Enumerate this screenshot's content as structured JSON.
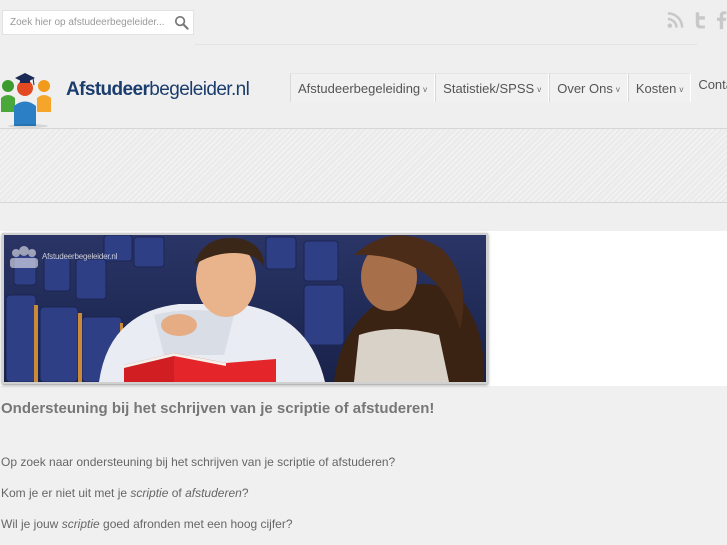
{
  "search": {
    "placeholder": "Zoek hier op afstudeerbegeleider..."
  },
  "social": [
    "rss-icon",
    "twitter-icon",
    "facebook-icon"
  ],
  "logo": {
    "bold": "Afstudeer",
    "light": "begeleider.nl"
  },
  "nav": [
    {
      "label": "Afstudeerbegeleiding",
      "dropdown": true
    },
    {
      "label": "Statistiek/SPSS",
      "dropdown": true
    },
    {
      "label": "Over Ons",
      "dropdown": true
    },
    {
      "label": "Kosten",
      "dropdown": true
    },
    {
      "label": "Contact",
      "dropdown": false
    }
  ],
  "nav_chevron": "v",
  "hero": {
    "watermark": "Afstudeerbegeleider.nl"
  },
  "main": {
    "headline": "Ondersteuning bij het schrijven van je scriptie of afstuderen!",
    "p1": "Op zoek naar ondersteuning bij het schrijven van je scriptie of afstuderen?",
    "p2_a": "Kom je er niet uit met je ",
    "p2_em1": "scriptie",
    "p2_b": " of ",
    "p2_em2": "afstuderen",
    "p2_c": "?",
    "p3_a": "Wil je jouw ",
    "p3_em": "scriptie",
    "p3_b": " goed afronden met een hoog cijfer?"
  },
  "colors": {
    "logo_blue": "#1b3d6e",
    "background": "#efefef",
    "text": "#666666"
  }
}
